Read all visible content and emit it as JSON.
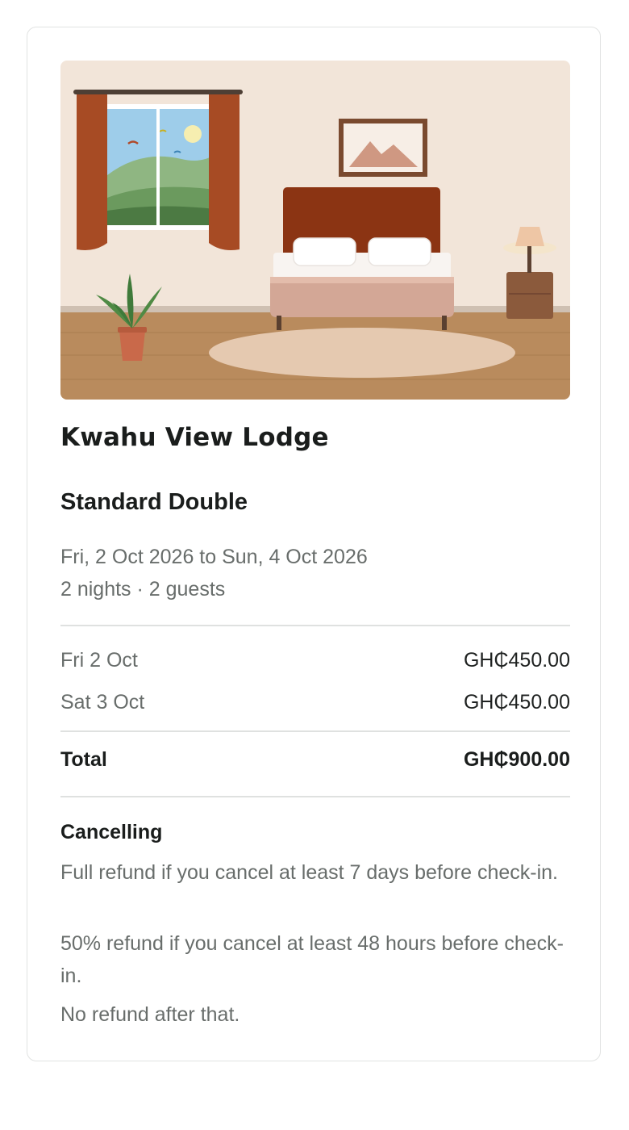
{
  "property": {
    "name": "Kwahu View Lodge",
    "image": "bedroom-illustration"
  },
  "room": {
    "type": "Standard Double",
    "dates": "Fri, 2 Oct 2026 to Sun, 4 Oct 2026",
    "summary": "2 nights · 2 guests"
  },
  "pricing": {
    "nights": [
      {
        "date": "Fri 2 Oct",
        "price": "GH₵450.00"
      },
      {
        "date": "Sat 3 Oct",
        "price": "GH₵450.00"
      }
    ],
    "total_label": "Total",
    "total_value": "GH₵900.00"
  },
  "cancellation": {
    "heading": "Cancelling",
    "policies": [
      "Full refund if you cancel at least 7 days before check-in.",
      "50% refund if you cancel at least 48 hours before check-in.",
      "No refund after that."
    ]
  },
  "colors": {
    "wall": "#f2e5d9",
    "floor": "#b98b5d",
    "headboard": "#8b3413",
    "curtain": "#a74b24",
    "text_primary": "#1a1d1c",
    "text_secondary": "#686d6b"
  }
}
